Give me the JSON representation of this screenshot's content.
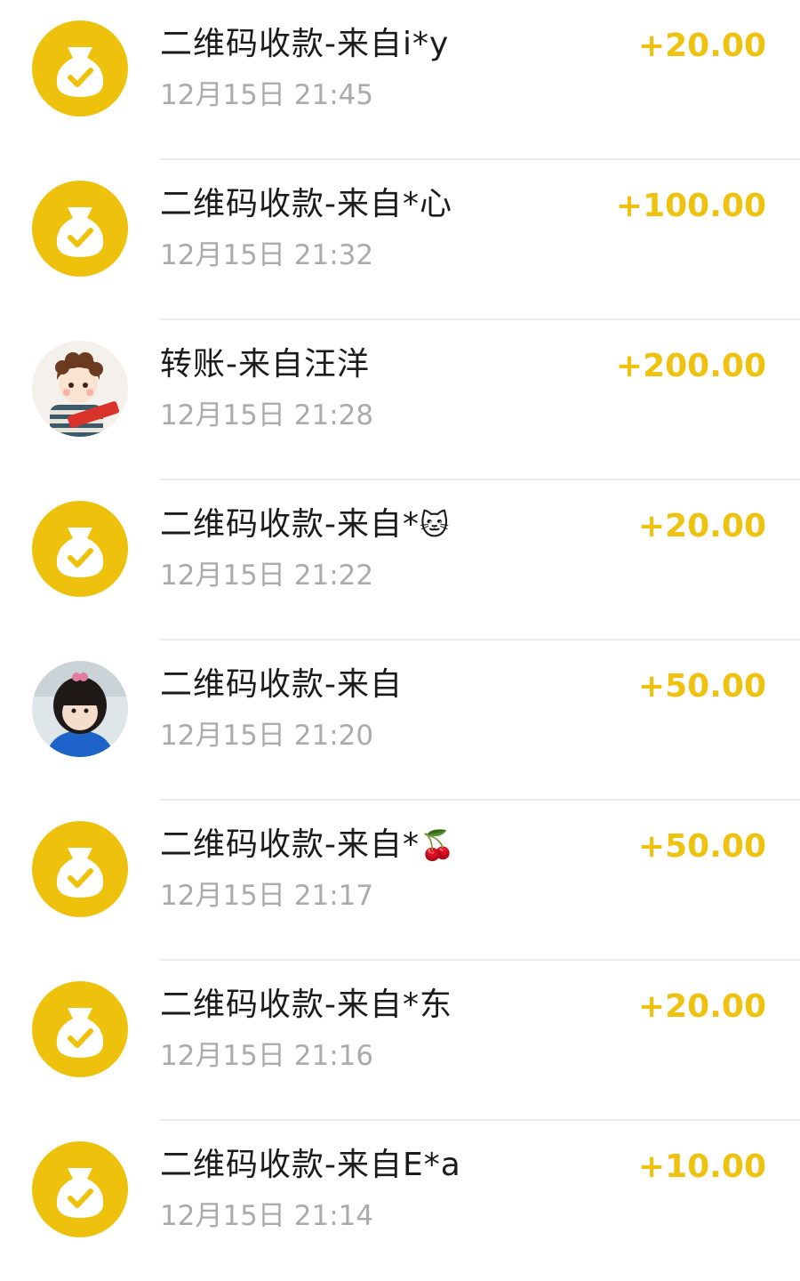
{
  "transactions": [
    {
      "title": "二维码收款-来自i*y",
      "time": "12月15日 21:45",
      "amount": "+20.00",
      "avatar": "money-bag-icon"
    },
    {
      "title": "二维码收款-来自*心",
      "time": "12月15日 21:32",
      "amount": "+100.00",
      "avatar": "money-bag-icon"
    },
    {
      "title": "转账-来自汪洋",
      "time": "12月15日 21:28",
      "amount": "+200.00",
      "avatar": "user-photo-boy"
    },
    {
      "title": "二维码收款-来自*",
      "title_emoji": "🐱",
      "time": "12月15日 21:22",
      "amount": "+20.00",
      "avatar": "money-bag-icon"
    },
    {
      "title": "二维码收款-来自",
      "time": "12月15日 21:20",
      "amount": "+50.00",
      "avatar": "user-photo-girl"
    },
    {
      "title": "二维码收款-来自*",
      "title_emoji": "🍒",
      "time": "12月15日 21:17",
      "amount": "+50.00",
      "avatar": "money-bag-icon"
    },
    {
      "title": "二维码收款-来自*东",
      "time": "12月15日 21:16",
      "amount": "+20.00",
      "avatar": "money-bag-icon"
    },
    {
      "title": "二维码收款-来自E*a",
      "time": "12月15日 21:14",
      "amount": "+10.00",
      "avatar": "money-bag-icon"
    }
  ],
  "colors": {
    "accent": "#efc20f",
    "coin_bg": "#eec20c",
    "title": "#1b1b1b",
    "time": "#ababab",
    "divider": "#ececec"
  }
}
